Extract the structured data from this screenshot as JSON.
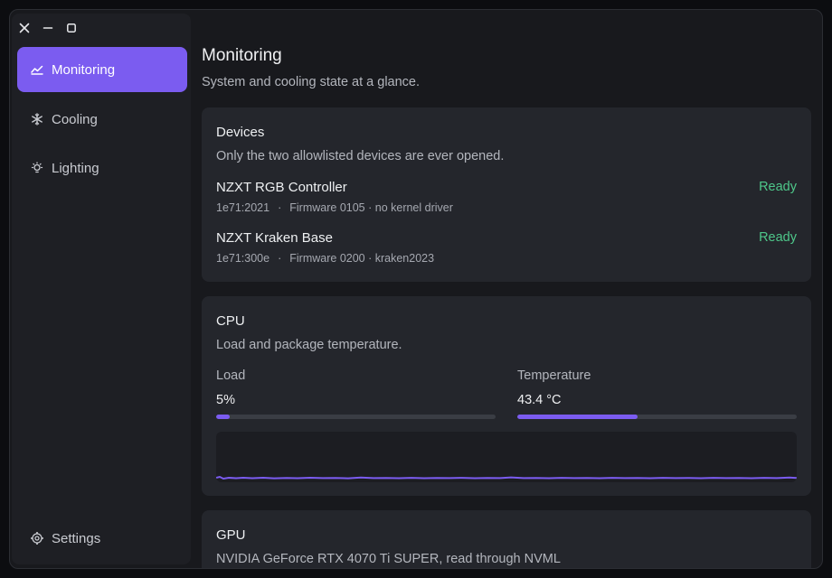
{
  "sidebar": {
    "items": [
      {
        "label": "Monitoring",
        "icon": "chart-icon",
        "active": true
      },
      {
        "label": "Cooling",
        "icon": "snowflake-icon",
        "active": false
      },
      {
        "label": "Lighting",
        "icon": "lightbulb-icon",
        "active": false
      }
    ],
    "settings_label": "Settings"
  },
  "page": {
    "title": "Monitoring",
    "subtitle": "System and cooling state at a glance."
  },
  "devices": {
    "title": "Devices",
    "subtitle": "Only the two allowlisted devices are ever opened.",
    "items": [
      {
        "name": "NZXT RGB Controller",
        "id": "1e71:2021",
        "info": "Firmware 0105 · no kernel driver",
        "status": "Ready"
      },
      {
        "name": "NZXT Kraken Base",
        "id": "1e71:300e",
        "info": "Firmware 0200 · kraken2023",
        "status": "Ready"
      }
    ]
  },
  "cpu": {
    "title": "CPU",
    "subtitle": "Load and package temperature.",
    "load_label": "Load",
    "load_value": "5%",
    "load_fraction": 0.05,
    "temp_label": "Temperature",
    "temp_value": "43.4 °C",
    "temp_fraction": 0.43
  },
  "gpu": {
    "title": "GPU",
    "subtitle": "NVIDIA GeForce RTX 4070 Ti SUPER, read through NVML"
  },
  "colors": {
    "accent": "#7b5cf0",
    "ready": "#4ec78a"
  }
}
